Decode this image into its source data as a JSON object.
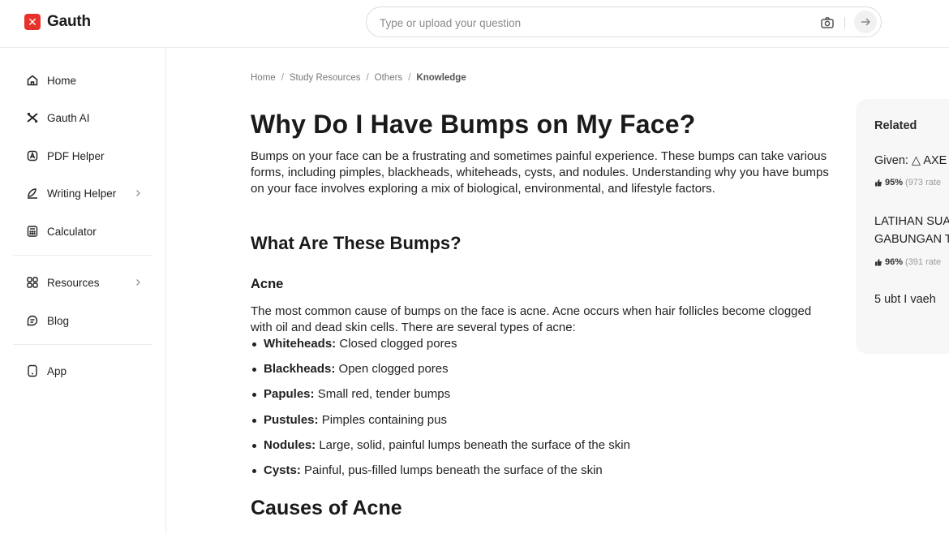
{
  "header": {
    "logo_text": "Gauth",
    "logo_mark": "✕",
    "search_placeholder": "Type or upload your question"
  },
  "sidebar": {
    "items": [
      {
        "label": "Home",
        "icon": "home-icon"
      },
      {
        "label": "Gauth AI",
        "icon": "gauth-ai-icon"
      },
      {
        "label": "PDF Helper",
        "icon": "pdf-icon"
      },
      {
        "label": "Writing Helper",
        "icon": "pen-icon",
        "has_chevron": true
      },
      {
        "label": "Calculator",
        "icon": "calculator-icon"
      },
      {
        "label": "Resources",
        "icon": "grid-icon",
        "has_chevron": true
      },
      {
        "label": "Blog",
        "icon": "blog-icon"
      },
      {
        "label": "App",
        "icon": "phone-icon"
      }
    ]
  },
  "breadcrumb": {
    "items": [
      "Home",
      "Study Resources",
      "Others",
      "Knowledge"
    ],
    "separator": "/"
  },
  "article": {
    "title": "Why Do I Have Bumps on My Face?",
    "intro": "Bumps on your face can be a frustrating and sometimes painful experience. These bumps can take various forms, including pimples, blackheads, whiteheads, cysts, and nodules. Understanding why you have bumps on your face involves exploring a mix of biological, environmental, and lifestyle factors.",
    "section1_title": "What Are These Bumps?",
    "subsection_title": "Acne",
    "acne_paragraph": "The most common cause of bumps on the face is acne. Acne occurs when hair follicles become clogged with oil and dead skin cells. There are several types of acne:",
    "acne_types": [
      {
        "term": "Whiteheads:",
        "desc": "Closed clogged pores"
      },
      {
        "term": "Blackheads:",
        "desc": "Open clogged pores"
      },
      {
        "term": "Papules:",
        "desc": "Small red, tender bumps"
      },
      {
        "term": "Pustules:",
        "desc": "Pimples containing pus"
      },
      {
        "term": "Nodules:",
        "desc": "Large, solid, painful lumps beneath the surface of the skin"
      },
      {
        "term": "Cysts:",
        "desc": "Painful, pus-filled lumps beneath the surface of the skin"
      }
    ],
    "section2_title": "Causes of Acne"
  },
  "related": {
    "heading": "Related",
    "items": [
      {
        "line1": "Given: △ AXE",
        "line2": "",
        "pct": "95%",
        "rating": "(973 rate"
      },
      {
        "line1": "LATIHAN SUA",
        "line2": "GABUNGAN T",
        "pct": "96%",
        "rating": "(391 rate"
      },
      {
        "line1": "5 ubt I vaeh",
        "line2": "",
        "pct": "",
        "rating": ""
      }
    ]
  },
  "colors": {
    "brand": "#e8322b",
    "text": "#1a1a1a",
    "muted": "#7a7a7a",
    "panel_bg": "#f7f7f8",
    "border": "#ececec"
  }
}
